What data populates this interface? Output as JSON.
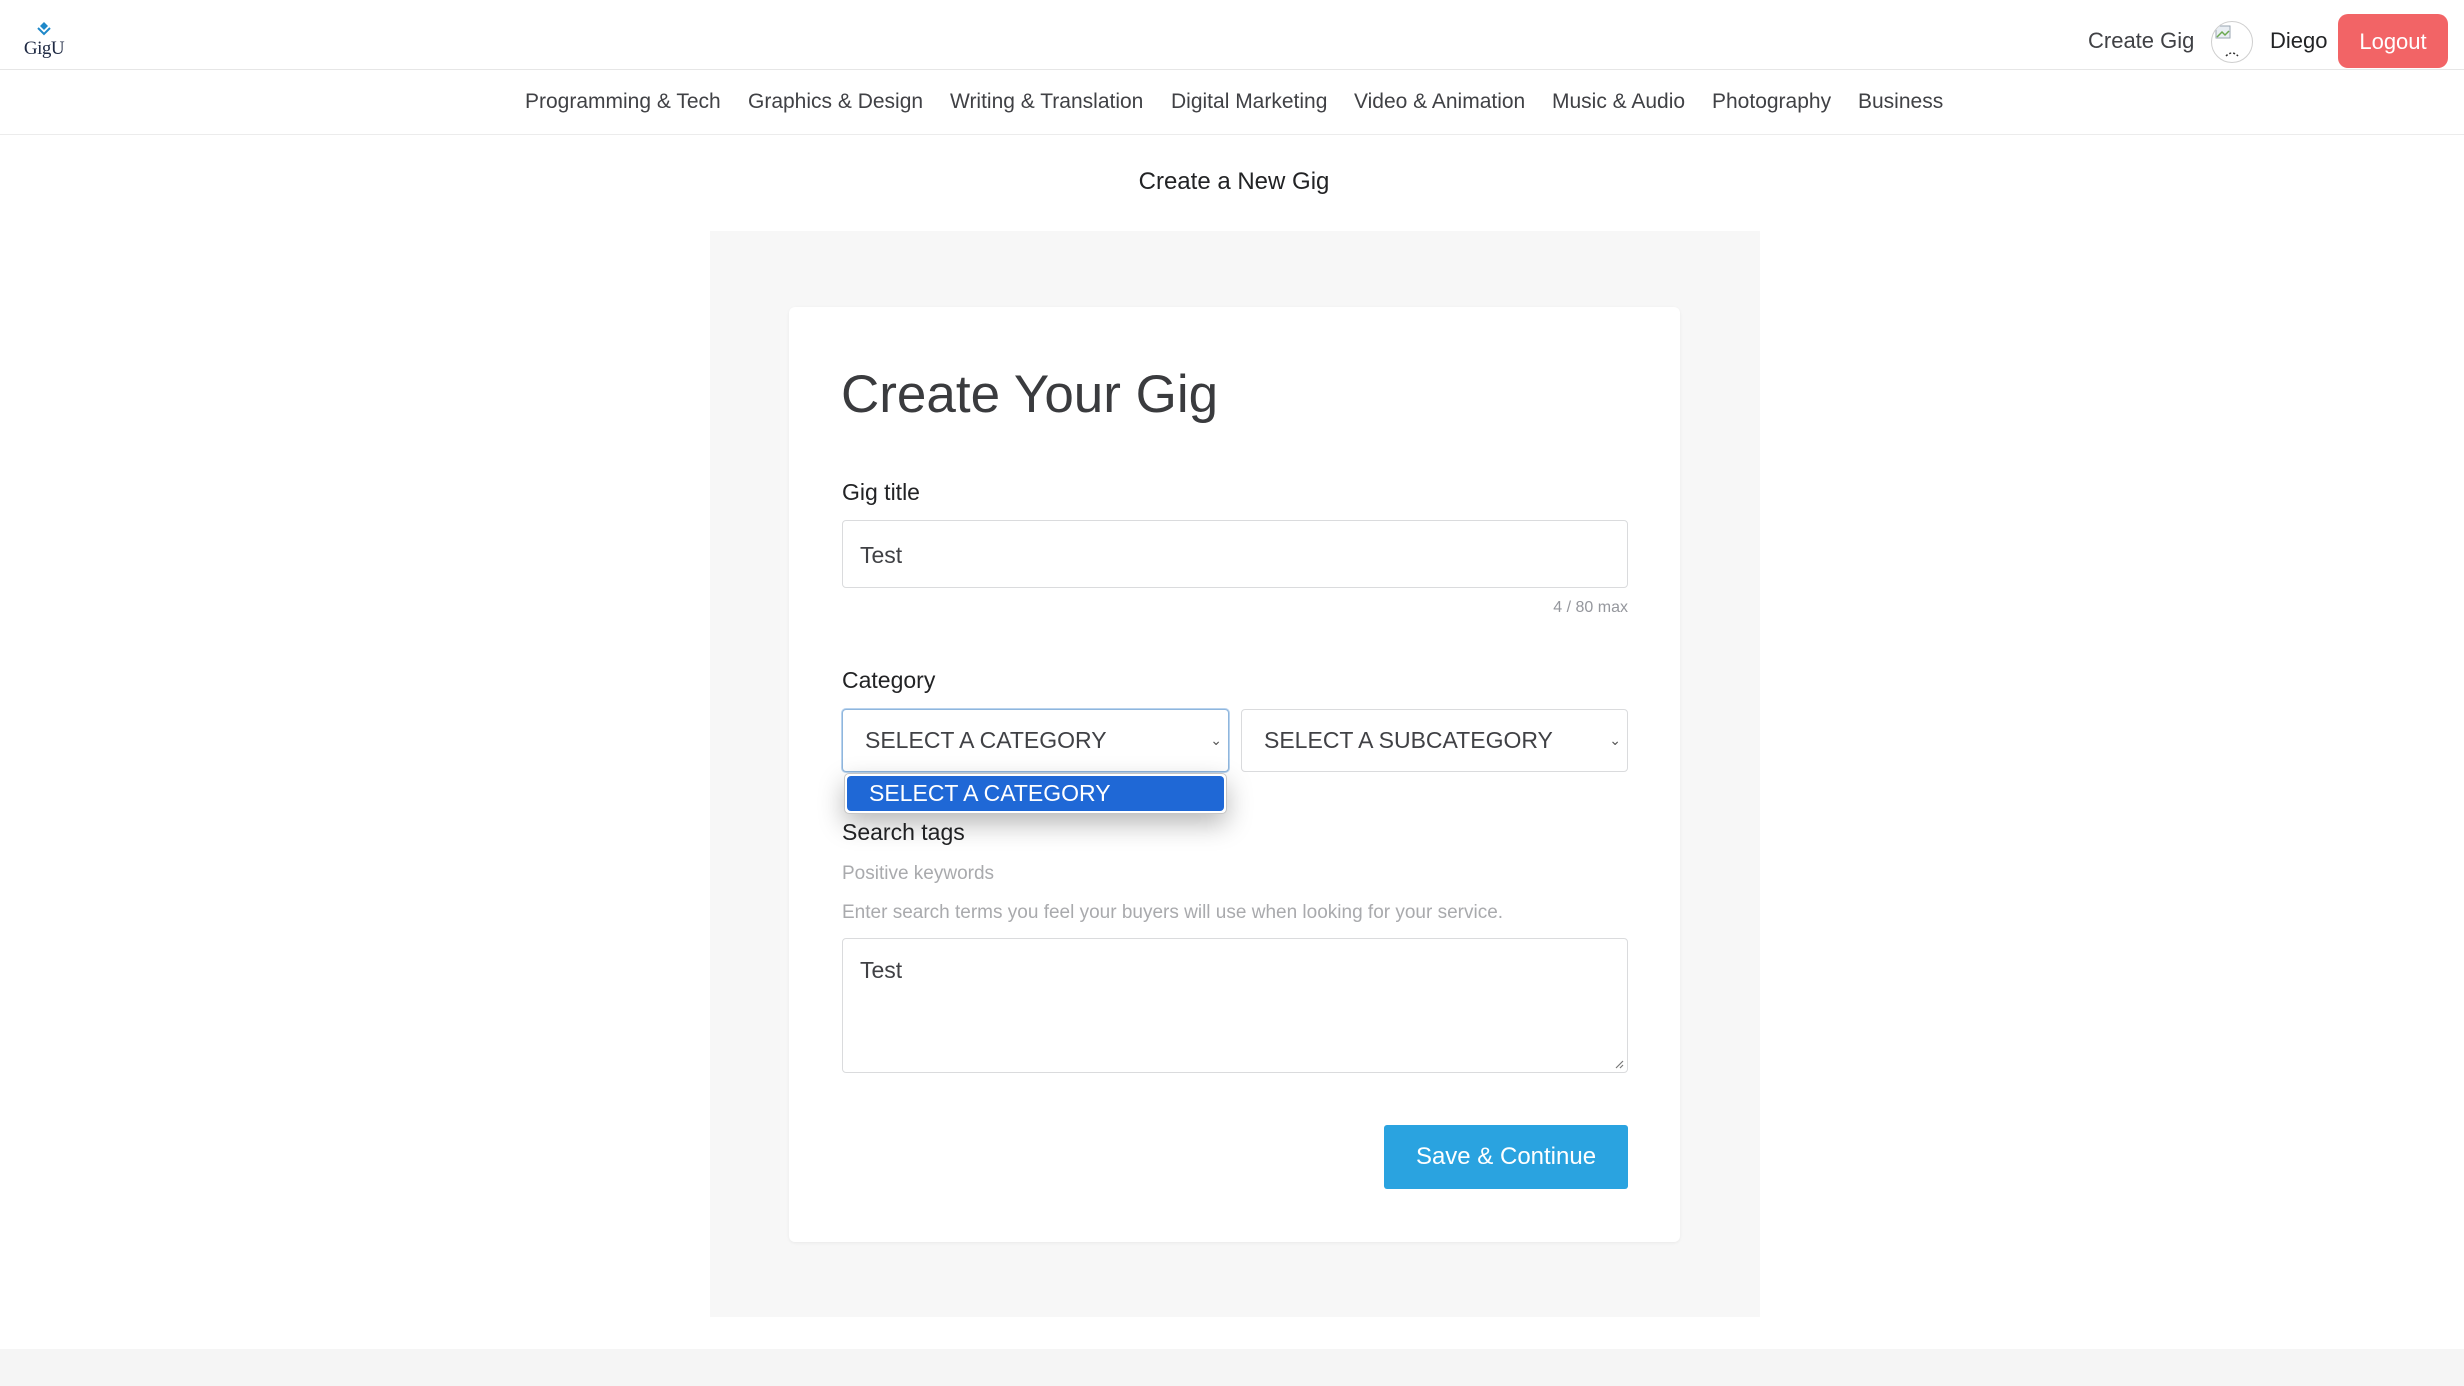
{
  "header": {
    "logo_text": "GigU",
    "create_gig_link": "Create Gig",
    "username": "Diego",
    "logout_label": "Logout"
  },
  "categories_nav": [
    "Programming & Tech",
    "Graphics & Design",
    "Writing & Translation",
    "Digital Marketing",
    "Video & Animation",
    "Music & Audio",
    "Photography",
    "Business"
  ],
  "page": {
    "heading": "Create a New Gig"
  },
  "form": {
    "title": "Create Your Gig",
    "gig_title_label": "Gig title",
    "gig_title_value": "Test",
    "gig_title_counter": "4 / 80 max",
    "category_label": "Category",
    "category_select_value": "SELECT A CATEGORY",
    "subcategory_select_value": "SELECT A SUBCATEGORY",
    "category_dropdown_options": [
      "SELECT A CATEGORY"
    ],
    "search_tags_label": "Search tags",
    "search_tags_sublabel": "Positive keywords",
    "search_tags_hint": "Enter search terms you feel your buyers will use when looking for your service.",
    "search_tags_value": "Test",
    "save_button_label": "Save & Continue"
  },
  "colors": {
    "logout_bg": "#f26466",
    "save_bg": "#2aa3e0",
    "dropdown_highlight": "#1f68d6",
    "panel_bg": "#f7f7f7"
  },
  "icons": {
    "logo_mark": "gigu-logo-mark-icon",
    "select_chevron": "chevron-down-icon",
    "textarea_resize": "resize-handle-icon"
  }
}
